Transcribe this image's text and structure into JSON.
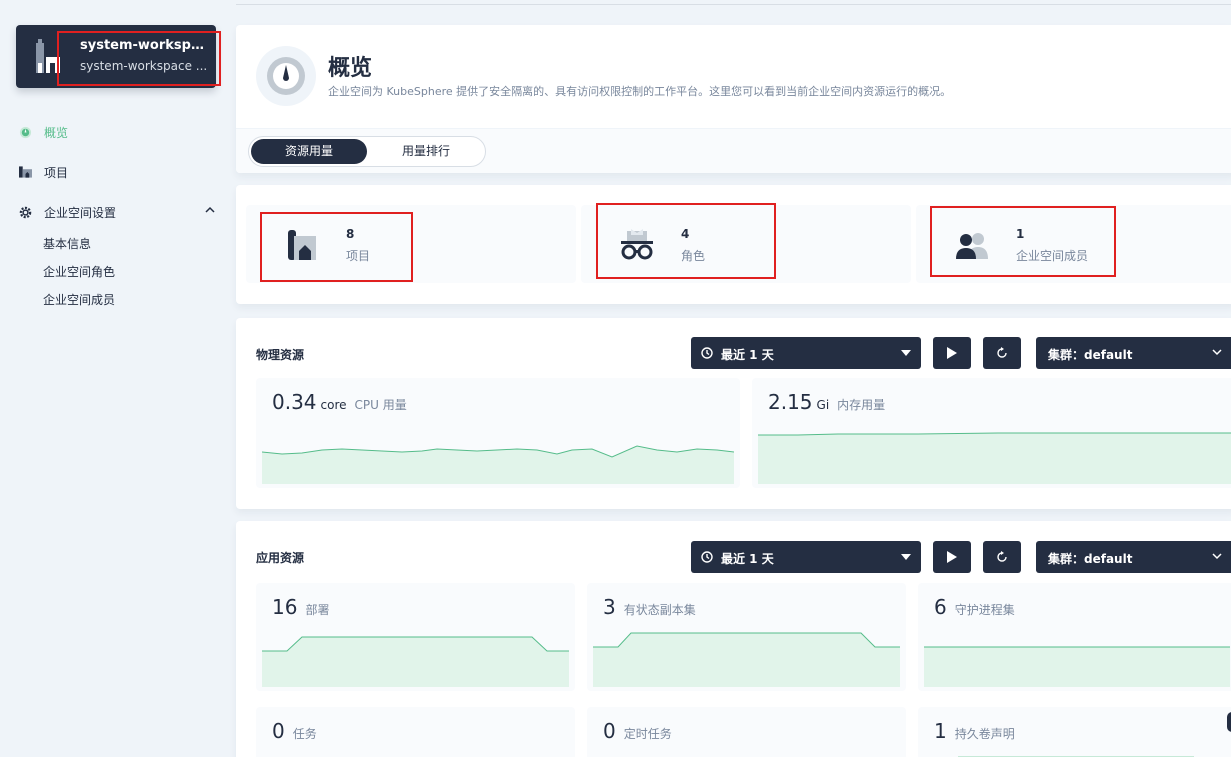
{
  "workspace": {
    "name": "system-workspa...",
    "subtitle": "system-workspace ..."
  },
  "nav": {
    "overview": "概览",
    "projects": "项目",
    "settings": "企业空间设置",
    "settings_items": [
      "基本信息",
      "企业空间角色",
      "企业空间成员"
    ]
  },
  "header": {
    "title": "概览",
    "description": "企业空间为 KubeSphere 提供了安全隔离的、具有访问权限控制的工作平台。这里您可以看到当前企业空间内资源运行的概况。",
    "tabs": [
      "资源用量",
      "用量排行"
    ]
  },
  "stats": [
    {
      "value": "8",
      "label": "项目",
      "icon": "project-icon"
    },
    {
      "value": "4",
      "label": "角色",
      "icon": "role-icon"
    },
    {
      "value": "1",
      "label": "企业空间成员",
      "icon": "members-icon"
    }
  ],
  "physical": {
    "title": "物理资源",
    "time_range": "最近 1 天",
    "cluster": "集群：default",
    "metrics": [
      {
        "value": "0.34",
        "unit": "core",
        "label": "CPU 用量"
      },
      {
        "value": "2.15",
        "unit": "Gi",
        "label": "内存用量"
      }
    ]
  },
  "application": {
    "title": "应用资源",
    "time_range": "最近 1 天",
    "cluster": "集群：default",
    "metrics": [
      {
        "value": "16",
        "label": "部署"
      },
      {
        "value": "3",
        "label": "有状态副本集"
      },
      {
        "value": "6",
        "label": "守护进程集"
      },
      {
        "value": "0",
        "label": "任务"
      },
      {
        "value": "0",
        "label": "定时任务"
      },
      {
        "value": "1",
        "label": "持久卷声明"
      }
    ]
  },
  "colors": {
    "dark": "#242e42",
    "accent": "#55bc8a",
    "highlight": "#e02020"
  }
}
